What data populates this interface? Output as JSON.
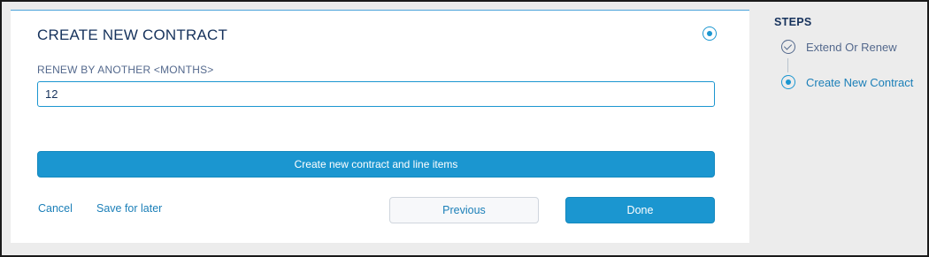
{
  "form": {
    "title": "CREATE NEW CONTRACT",
    "field_label": "RENEW BY ANOTHER <MONTHS>",
    "field_value": "12",
    "create_button_label": "Create new contract and line items",
    "cancel_label": "Cancel",
    "save_for_later_label": "Save for later",
    "previous_label": "Previous",
    "done_label": "Done"
  },
  "steps": {
    "heading": "STEPS",
    "items": [
      {
        "label": "Extend Or Renew",
        "state": "complete",
        "icon": "check-circle-icon"
      },
      {
        "label": "Create New Contract",
        "state": "current",
        "icon": "current-step-icon"
      }
    ]
  },
  "colors": {
    "accent": "#1b96d0",
    "link": "#1b7fb8",
    "text_dark": "#16325c",
    "text_muted": "#54698d",
    "background": "#ececec"
  }
}
